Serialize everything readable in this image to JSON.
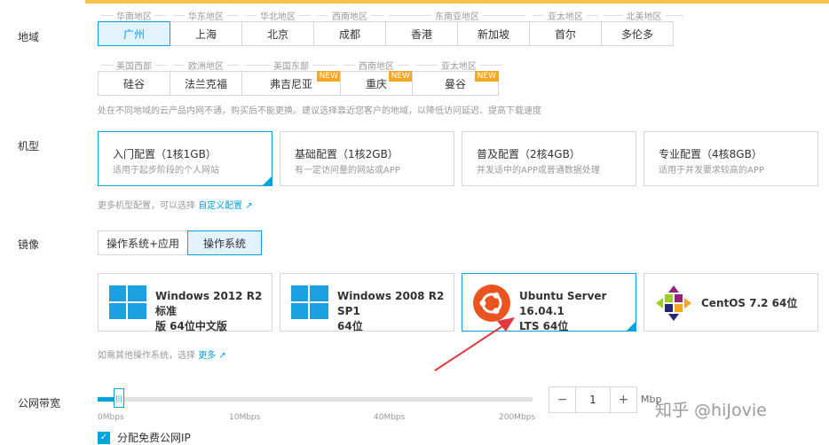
{
  "region": {
    "label": "地域",
    "row1_groups": [
      "华南地区",
      "华东地区",
      "华北地区",
      "西南地区",
      "东南亚地区",
      "亚太地区",
      "北美地区"
    ],
    "row1": [
      "广州",
      "上海",
      "北京",
      "成都",
      "香港",
      "新加坡",
      "首尔",
      "多伦多"
    ],
    "row2_groups": [
      "美国西部",
      "欧洲地区",
      "美国东部",
      "西南地区",
      "亚太地区"
    ],
    "row2": [
      "硅谷",
      "法兰克福",
      "弗吉尼亚",
      "重庆",
      "曼谷"
    ],
    "new_badge": "NEW",
    "hint": "处在不同地域的云产品内网不通，购买后不能更换。建议选择靠近您客户的地域，以降低访问延迟、提高下载速度"
  },
  "model": {
    "label": "机型",
    "cards": [
      {
        "title": "入门配置（1核1GB）",
        "sub": "适用于起步阶段的个人网站"
      },
      {
        "title": "基础配置（1核2GB）",
        "sub": "有一定访问量的网站或APP"
      },
      {
        "title": "普及配置（2核4GB）",
        "sub": "并发适中的APP或普通数据处理"
      },
      {
        "title": "专业配置（4核8GB）",
        "sub": "适用于并发要求较高的APP"
      }
    ],
    "more_text": "更多机型配置，可以选择",
    "more_link": "自定义配置"
  },
  "image": {
    "label": "镜像",
    "tabs": [
      "操作系统+应用",
      "操作系统"
    ],
    "os": [
      {
        "line1": "Windows 2012 R2 标准",
        "line2": "版 64位中文版",
        "icon": "windows-icon"
      },
      {
        "line1": "Windows 2008 R2 SP1",
        "line2": "64位",
        "icon": "windows-icon"
      },
      {
        "line1": "Ubuntu Server 16.04.1",
        "line2": "LTS 64位",
        "icon": "ubuntu-icon"
      },
      {
        "line1": "CentOS 7.2 64位",
        "line2": "",
        "icon": "centos-icon"
      }
    ],
    "more_text": "如需其他操作系统，选择",
    "more_link": "更多"
  },
  "bandwidth": {
    "label": "公网带宽",
    "ticks": [
      "0Mbps",
      "10Mbps",
      "40Mbps",
      "200Mbps"
    ],
    "value": "1",
    "unit": "Mbp",
    "minus": "−",
    "plus": "+",
    "free_ip": "分配免费公网IP",
    "level": 0.02
  },
  "watermark": "知乎 @hiJovie",
  "colors": {
    "accent": "#00a2e0",
    "new": "#f5a623",
    "arrow": "#e0383e"
  }
}
